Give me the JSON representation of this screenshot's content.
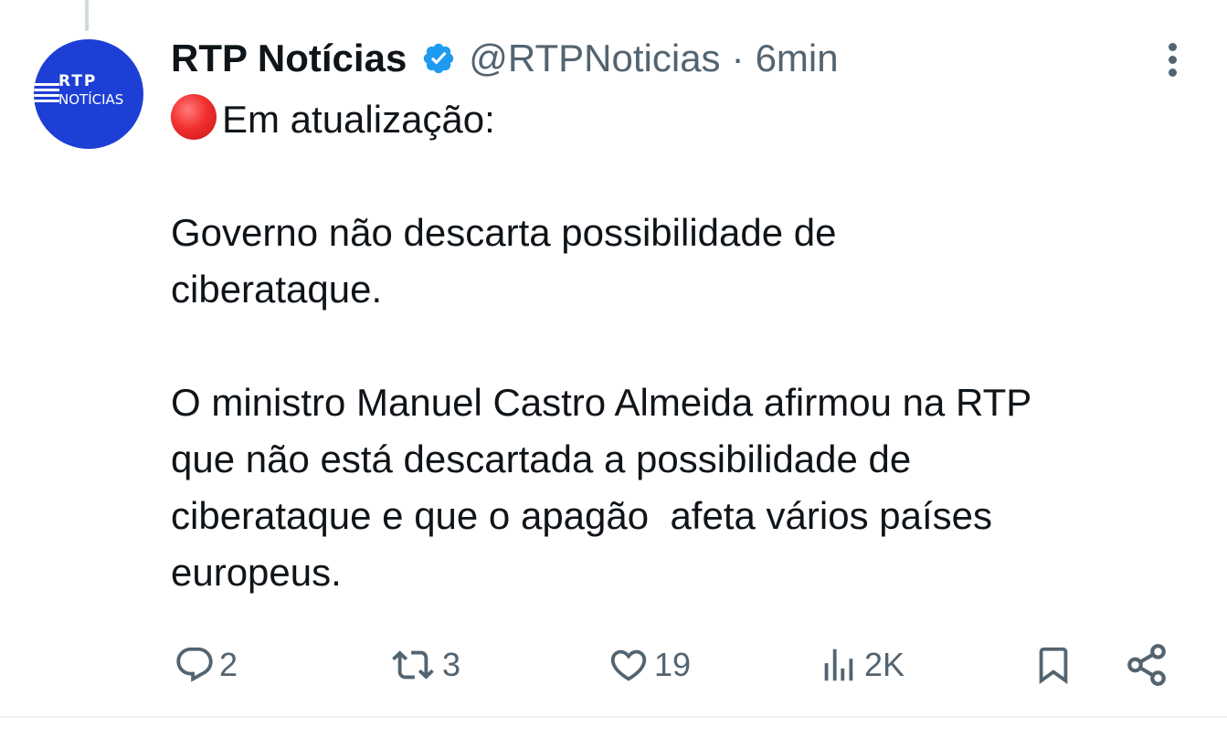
{
  "tweet": {
    "author": {
      "display_name": "RTP Notícias",
      "handle": "@RTPNoticias",
      "verified": true,
      "avatar": {
        "line1": "RTP",
        "line2": "NOTÍCIAS",
        "bg_color": "#1d3fd6"
      }
    },
    "separator": "·",
    "time": "6min",
    "more_icon": "more-vertical-icon",
    "text": {
      "headline": "Em atualização:",
      "headline_emoji": "red-circle-icon",
      "paragraph1_line1": "Governo não descarta possibilidade de",
      "paragraph1_line2": "ciberataque.",
      "paragraph2_line1": "O ministro Manuel Castro Almeida afirmou na RTP",
      "paragraph2_line2": "que não está descartada a possibilidade de",
      "paragraph2_line3": "ciberataque e que o apagão  afeta vários países",
      "paragraph2_line4": "europeus."
    },
    "actions": {
      "replies": {
        "icon": "reply-icon",
        "count": "2"
      },
      "reposts": {
        "icon": "repost-icon",
        "count": "3"
      },
      "likes": {
        "icon": "heart-icon",
        "count": "19"
      },
      "views": {
        "icon": "views-icon",
        "count": "2K"
      },
      "bookmark": {
        "icon": "bookmark-icon"
      },
      "share": {
        "icon": "share-icon"
      }
    }
  },
  "colors": {
    "text_primary": "#0f1419",
    "text_secondary": "#536471",
    "verified_blue": "#1d9bf0",
    "divider": "#eff3f4"
  }
}
